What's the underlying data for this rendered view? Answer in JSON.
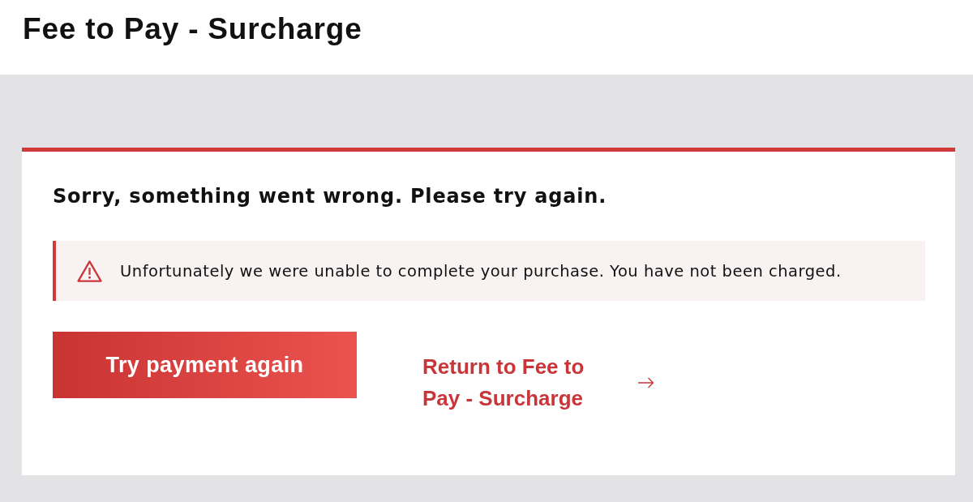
{
  "page_title": "Fee to Pay - Surcharge",
  "card": {
    "heading": "Sorry, something went wrong. Please try again.",
    "alert": {
      "kind": "error",
      "message": "Unfortunately we were unable to complete your purchase. You have not been charged."
    },
    "actions": [
      {
        "kind": "button",
        "label": "Try payment again"
      },
      {
        "kind": "link",
        "label": "Return to Fee to Pay - Surcharge"
      }
    ]
  }
}
